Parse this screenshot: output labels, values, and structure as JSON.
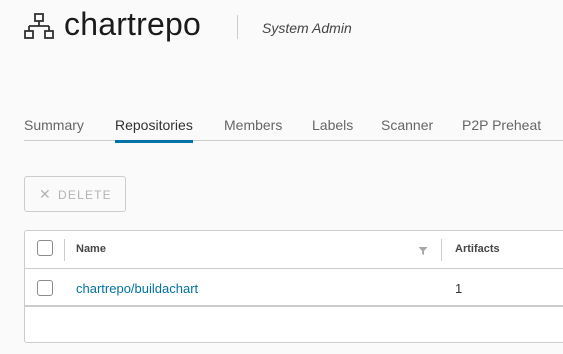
{
  "project": {
    "name": "chartrepo",
    "role": "System Admin",
    "icon": "project-icon"
  },
  "tabs": [
    {
      "label": "Summary",
      "active": false
    },
    {
      "label": "Repositories",
      "active": true
    },
    {
      "label": "Members",
      "active": false
    },
    {
      "label": "Labels",
      "active": false
    },
    {
      "label": "Scanner",
      "active": false
    },
    {
      "label": "P2P Preheat",
      "active": false
    }
  ],
  "toolbar": {
    "delete_label": "DELETE",
    "delete_icon": "close-icon",
    "delete_disabled": true
  },
  "table": {
    "columns": [
      "Name",
      "Artifacts"
    ],
    "rows": [
      {
        "name": "chartrepo/buildachart",
        "artifacts": "1"
      }
    ]
  },
  "colors": {
    "accent": "#0072a3",
    "text": "#313131",
    "border": "#cccccc",
    "background": "#fafafa"
  }
}
